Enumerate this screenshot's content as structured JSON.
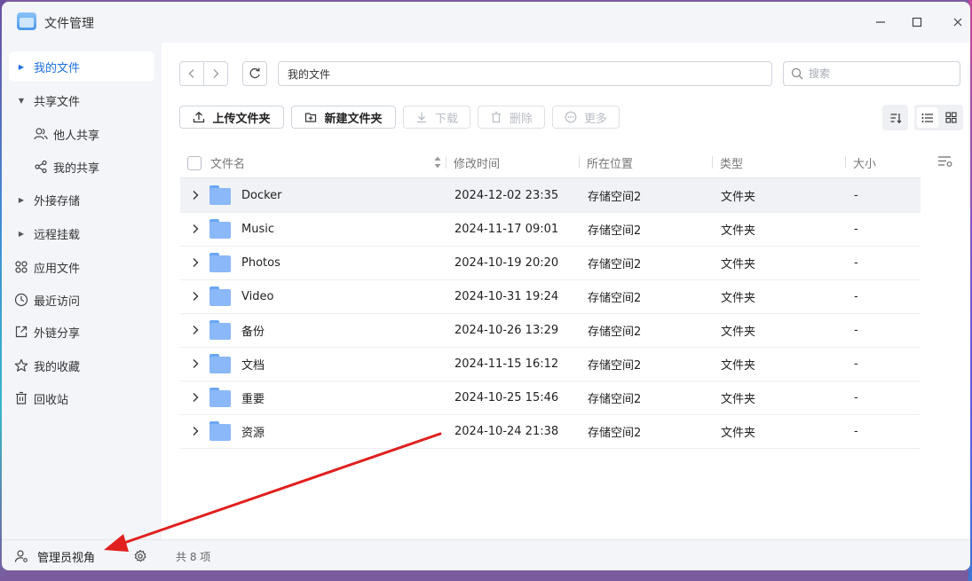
{
  "window": {
    "title": "文件管理",
    "controls": [
      "minimize-icon",
      "maximize-icon",
      "close-icon"
    ]
  },
  "sidebar": {
    "items": [
      {
        "label": "我的文件",
        "icon": "caret-right-icon",
        "active": true
      },
      {
        "label": "共享文件",
        "icon": "caret-down-icon"
      },
      {
        "label": "他人共享",
        "icon": "users-icon"
      },
      {
        "label": "我的共享",
        "icon": "share-icon"
      },
      {
        "label": "外接存储",
        "icon": "caret-right-icon"
      },
      {
        "label": "远程挂载",
        "icon": "caret-right-icon"
      },
      {
        "label": "应用文件",
        "icon": "apps-icon"
      },
      {
        "label": "最近访问",
        "icon": "clock-icon"
      },
      {
        "label": "外链分享",
        "icon": "external-link-icon"
      },
      {
        "label": "我的收藏",
        "icon": "star-icon"
      },
      {
        "label": "回收站",
        "icon": "trash-icon"
      }
    ],
    "admin_view_label": "管理员视角"
  },
  "toolbar": {
    "path": "我的文件",
    "search_placeholder": "搜索",
    "upload_folder": "上传文件夹",
    "new_folder": "新建文件夹",
    "download": "下载",
    "delete": "删除",
    "more": "更多"
  },
  "table": {
    "columns": [
      "文件名",
      "修改时间",
      "所在位置",
      "类型",
      "大小"
    ],
    "rows": [
      {
        "name": "Docker",
        "modified": "2024-12-02 23:35",
        "location": "存储空间2",
        "type": "文件夹",
        "size": "-"
      },
      {
        "name": "Music",
        "modified": "2024-11-17 09:01",
        "location": "存储空间2",
        "type": "文件夹",
        "size": "-"
      },
      {
        "name": "Photos",
        "modified": "2024-10-19 20:20",
        "location": "存储空间2",
        "type": "文件夹",
        "size": "-"
      },
      {
        "name": "Video",
        "modified": "2024-10-31 19:24",
        "location": "存储空间2",
        "type": "文件夹",
        "size": "-"
      },
      {
        "name": "备份",
        "modified": "2024-10-26 13:29",
        "location": "存储空间2",
        "type": "文件夹",
        "size": "-"
      },
      {
        "name": "文档",
        "modified": "2024-11-15 16:12",
        "location": "存储空间2",
        "type": "文件夹",
        "size": "-"
      },
      {
        "name": "重要",
        "modified": "2024-10-25 15:46",
        "location": "存储空间2",
        "type": "文件夹",
        "size": "-"
      },
      {
        "name": "资源",
        "modified": "2024-10-24 21:38",
        "location": "存储空间2",
        "type": "文件夹",
        "size": "-"
      }
    ]
  },
  "footer": {
    "count_label": "共 8 项"
  },
  "colors": {
    "accent": "#1e6fe0",
    "annotation_arrow": "#e0201f",
    "folder": "#8ab8f8"
  }
}
